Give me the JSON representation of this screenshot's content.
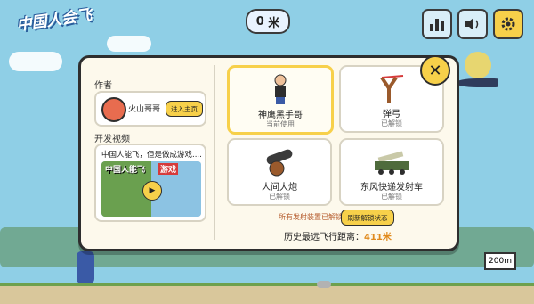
{
  "game": {
    "logo": "中国人会飞"
  },
  "hud": {
    "distance_value": "0",
    "distance_unit": "米",
    "buttons": [
      "leaderboard-icon",
      "sound-icon",
      "settings-icon"
    ]
  },
  "scene": {
    "distance_marker": "200m"
  },
  "panel": {
    "author_label": "作者",
    "author_name": "火山哥哥",
    "home_button": "进入主页",
    "video_label": "开发视频",
    "video_title": "中国人能飞，但是做成游戏......",
    "video_thumb_text_left": "中国人能飞",
    "video_thumb_text_right": "游戏",
    "launchers": [
      {
        "name": "神鹰黑手哥",
        "status": "当前使用",
        "icon": "strongman-icon",
        "selected": true
      },
      {
        "name": "弹弓",
        "status": "已解锁",
        "icon": "slingshot-icon",
        "selected": false
      },
      {
        "name": "人间大炮",
        "status": "已解锁",
        "icon": "cannon-icon",
        "selected": false
      },
      {
        "name": "东风快递发射车",
        "status": "已解锁",
        "icon": "missile-truck-icon",
        "selected": false
      }
    ],
    "unlock_note": "所有发射装置已解锁",
    "refresh_button": "刷新解锁状态",
    "record_label": "历史最远飞行距离：",
    "record_value": "411米"
  },
  "colors": {
    "accent": "#f7d04a",
    "record": "#e08a1c",
    "sky": "#8fcfe6"
  }
}
